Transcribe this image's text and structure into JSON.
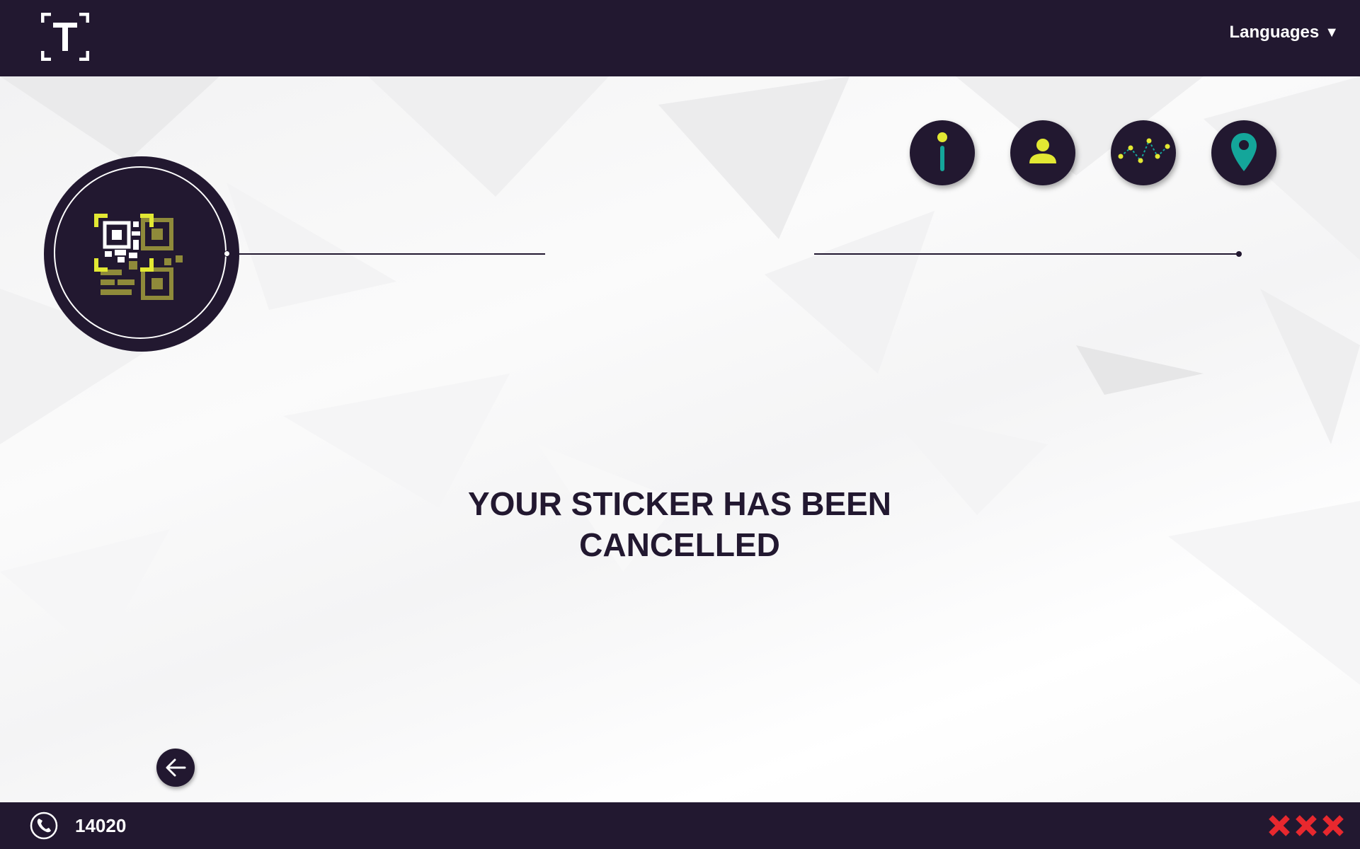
{
  "header": {
    "logo_icon": "t-bracket-logo-icon",
    "languages_label": "Languages",
    "languages_caret": "▼"
  },
  "steps": [
    {
      "name": "info",
      "icon": "info-icon"
    },
    {
      "name": "user",
      "icon": "user-icon"
    },
    {
      "name": "route",
      "icon": "route-icon"
    },
    {
      "name": "location",
      "icon": "location-pin-icon"
    }
  ],
  "status": {
    "icon": "qr-code-icon",
    "message_line1": "YOUR STICKER HAS BEEN",
    "message_line2": "CANCELLED"
  },
  "navigation": {
    "back_icon": "arrow-left-icon"
  },
  "footer": {
    "phone_icon": "phone-icon",
    "phone_number": "14020",
    "brand_marks": "xxx-icon"
  },
  "colors": {
    "dark": "#221830",
    "accent_yellow": "#e2e833",
    "accent_teal": "#14a69a",
    "qr_olive": "#8f8a3a",
    "mark_red": "#e8282e",
    "background": "#ffffff"
  }
}
